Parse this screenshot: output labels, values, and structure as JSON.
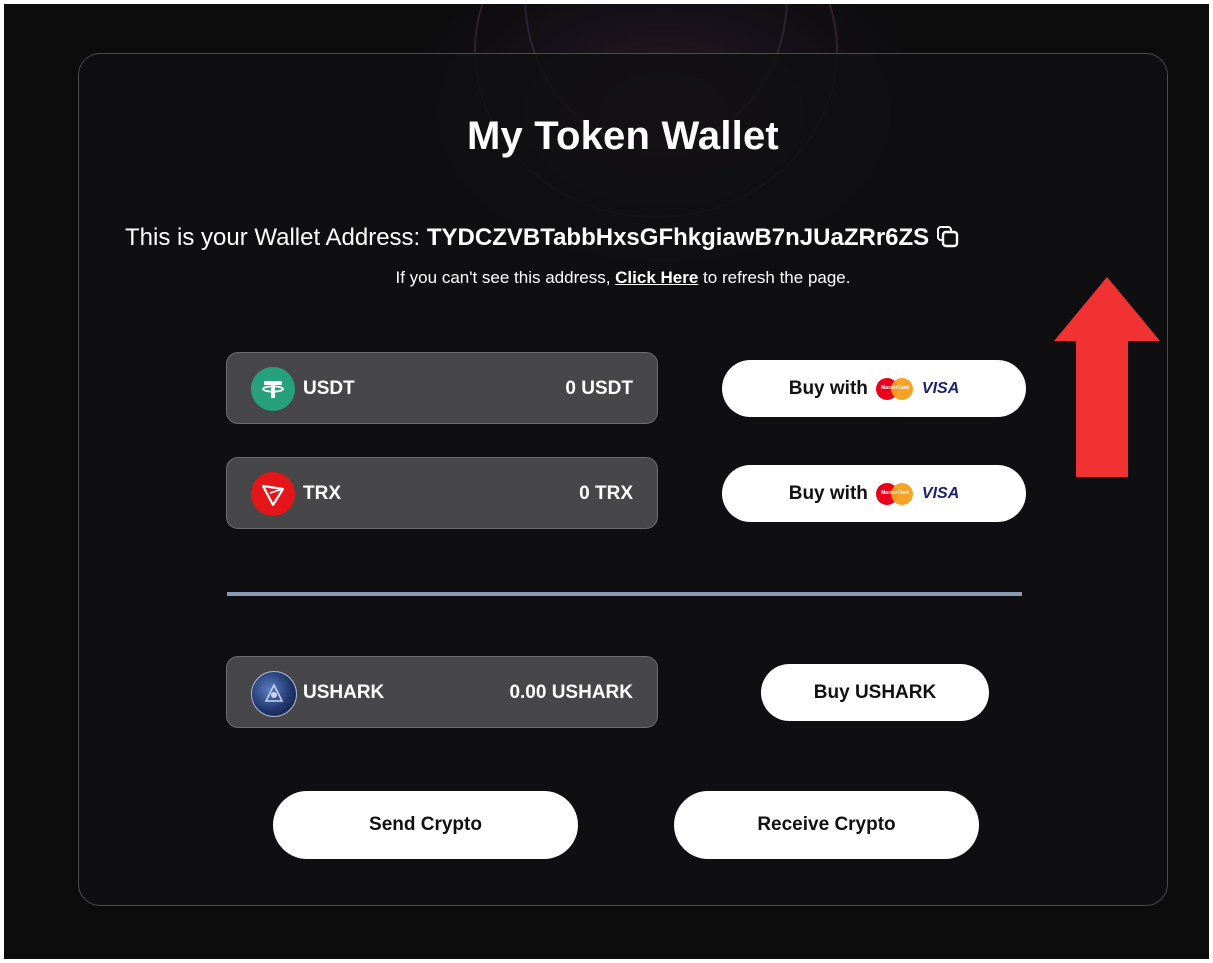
{
  "wallet": {
    "title": "My Token Wallet",
    "address_label": "This is your Wallet Address: ",
    "address": "TYDCZVBTabbHxsGFhkgiawB7nJUaZRr6ZS",
    "refresh_prefix": "If you can't see this address, ",
    "refresh_link": "Click Here",
    "refresh_suffix": " to refresh the page."
  },
  "tokens": [
    {
      "name": "USDT",
      "balance": "0 USDT",
      "icon": "tether-icon",
      "color": "#26a17b"
    },
    {
      "name": "TRX",
      "balance": "0 TRX",
      "icon": "tron-icon",
      "color": "#e5161a"
    }
  ],
  "buy_with": {
    "label": "Buy with",
    "mastercard_text": "MasterCard",
    "visa_text": "VISA"
  },
  "ushark": {
    "name": "USHARK",
    "balance": "0.00 USHARK",
    "icon": "ushark-icon",
    "buy_label": "Buy USHARK"
  },
  "actions": {
    "send_label": "Send Crypto",
    "receive_label": "Receive Crypto"
  },
  "colors": {
    "background": "#0c0c0d",
    "pill": "#474749",
    "divider": "#8a9ab4",
    "arrow": "#f03232"
  }
}
